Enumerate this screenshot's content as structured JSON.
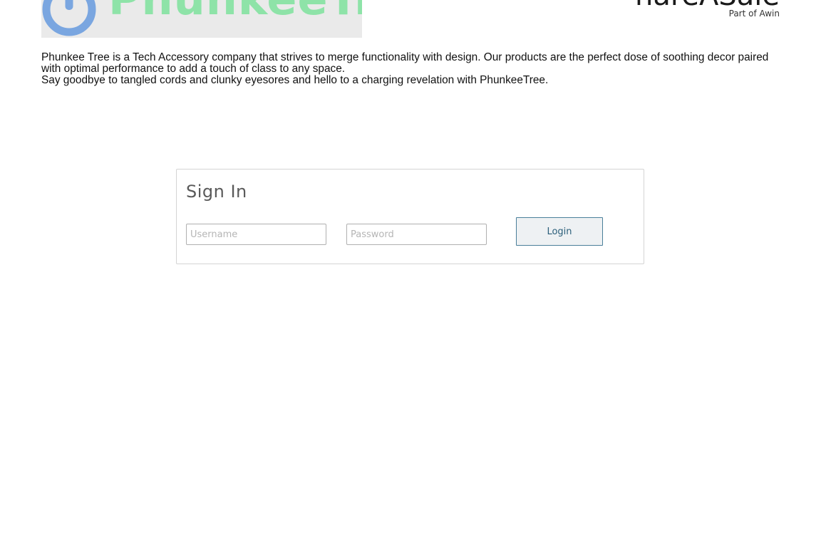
{
  "brand": {
    "name": "PhunkeeTree",
    "icon": "power-icon",
    "icon_color": "#7aa6e0",
    "name_color": "#8ee3a8",
    "banner_color": "#eaeaea"
  },
  "partner": {
    "name": "ShareASale",
    "tagline": "Part of Awin"
  },
  "intro": {
    "line1": "Phunkee Tree is a Tech Accessory company that strives to merge functionality with design. Our products are the perfect dose of soothing decor paired with optimal performance to add a touch of class to any space.",
    "line2": "Say goodbye to tangled cords and clunky eyesores and hello to a charging revelation with PhunkeeTree."
  },
  "signin": {
    "title": "Sign In",
    "username_placeholder": "Username",
    "username_value": "",
    "password_placeholder": "Password",
    "password_value": "",
    "login_label": "Login"
  }
}
